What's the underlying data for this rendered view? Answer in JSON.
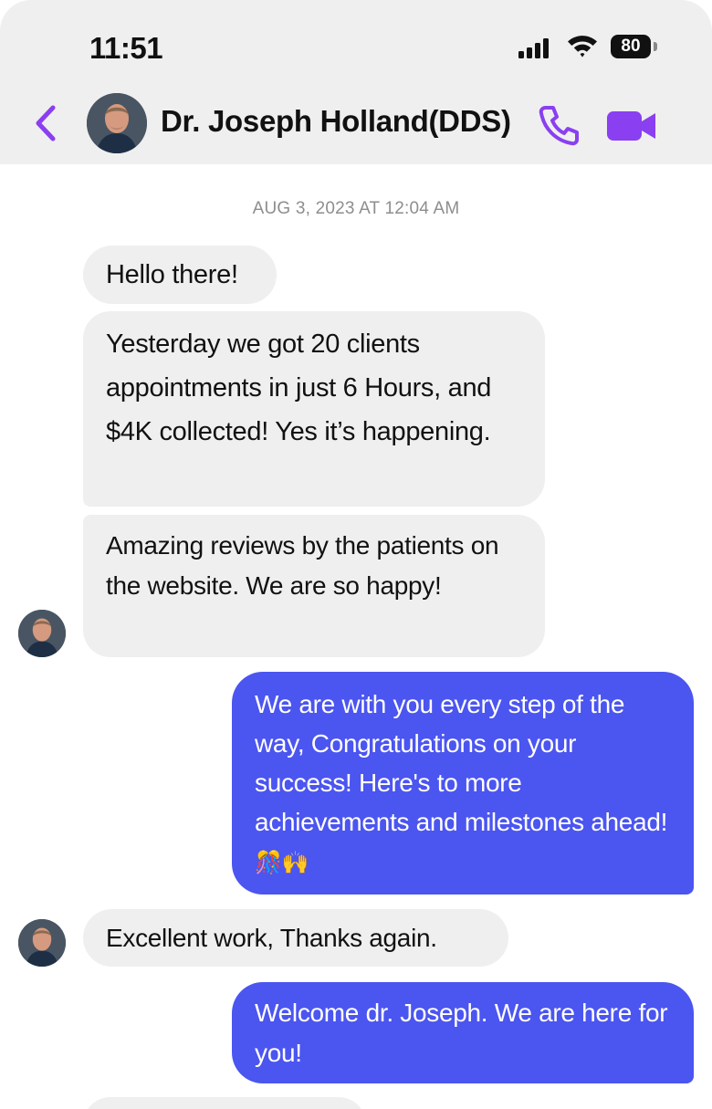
{
  "status_bar": {
    "time": "11:51",
    "battery": "80"
  },
  "header": {
    "contact_name": "Dr. Joseph Holland(DDS)",
    "accent_color": "#8a3ff0",
    "icons": [
      "back-chevron-icon",
      "phone-icon",
      "video-camera-icon"
    ]
  },
  "conversation": {
    "timestamp": "AUG 3, 2023 AT 12:04 AM",
    "messages": [
      {
        "direction": "incoming",
        "text": "Hello there!"
      },
      {
        "direction": "incoming",
        "text": "Yesterday we got 20 clients appointments in just 6 Hours, and $4K collected! Yes it’s happening."
      },
      {
        "direction": "incoming",
        "text": "Amazing reviews by the patients on the website. We are so happy!"
      },
      {
        "direction": "outgoing",
        "text": "We are with you every step of the way, Congratulations on your success! Here's to more achievements and milestones ahead!",
        "emoji": "🎊🙌"
      },
      {
        "direction": "incoming",
        "text": "Excellent work, Thanks again."
      },
      {
        "direction": "outgoing",
        "text": "Welcome dr. Joseph. We are here for you!"
      }
    ]
  },
  "colors": {
    "incoming_bubble": "#efefef",
    "outgoing_bubble": "#4b55f0",
    "header_background": "#efefef"
  }
}
